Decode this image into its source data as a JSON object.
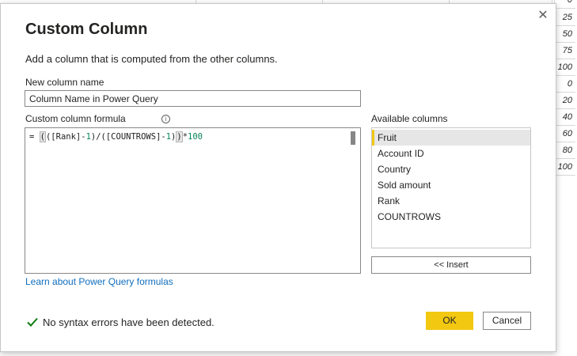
{
  "background_grid": {
    "values": [
      "0",
      "25",
      "50",
      "75",
      "100",
      "0",
      "20",
      "40",
      "60",
      "80",
      "100"
    ]
  },
  "dialog": {
    "title": "Custom Column",
    "subtitle": "Add a column that is computed from the other columns.",
    "close_glyph": "✕",
    "new_column_label": "New column name",
    "new_column_value": "Column Name in Power Query",
    "formula_label": "Custom column formula",
    "info_glyph": "i",
    "formula": {
      "prefix": "= ",
      "open_paren": "(",
      "middle": "([Rank]-",
      "num1": "1",
      "middle2": ")/([COUNTROWS]-",
      "num2": "1",
      "middle3": ")",
      "close_paren": ")",
      "suffix": "*",
      "num3": "100"
    },
    "learn_link": "Learn about Power Query formulas",
    "available_columns_label": "Available columns",
    "available_columns": [
      "Fruit",
      "Account ID",
      "Country",
      "Sold amount",
      "Rank",
      "COUNTROWS"
    ],
    "selected_column": "Fruit",
    "insert_button": "<< Insert",
    "status_text": "No syntax errors have been detected.",
    "ok_button": "OK",
    "cancel_button": "Cancel"
  },
  "colors": {
    "accent": "#f2c811",
    "link": "#106ebe",
    "success": "#107c10"
  }
}
